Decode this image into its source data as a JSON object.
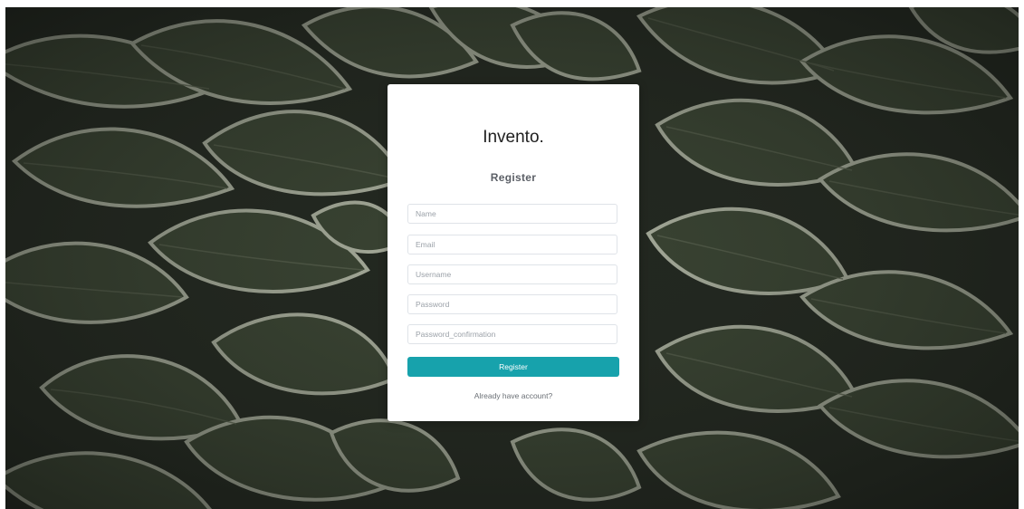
{
  "app": {
    "brand": "Invento."
  },
  "form": {
    "heading": "Register",
    "fields": [
      {
        "name": "name",
        "placeholder": "Name",
        "value": ""
      },
      {
        "name": "email",
        "placeholder": "Email",
        "value": ""
      },
      {
        "name": "username",
        "placeholder": "Username",
        "value": ""
      },
      {
        "name": "password",
        "placeholder": "Password",
        "value": ""
      },
      {
        "name": "password_confirmation",
        "placeholder": "Password_confirmation",
        "value": ""
      }
    ],
    "submit_label": "Register",
    "login_link": "Already have account?"
  },
  "colors": {
    "accent": "#17a2ac",
    "card_background": "#ffffff",
    "backdrop": "#1f231d"
  },
  "background": {
    "description_icon": "hosta-leaves-photo"
  }
}
